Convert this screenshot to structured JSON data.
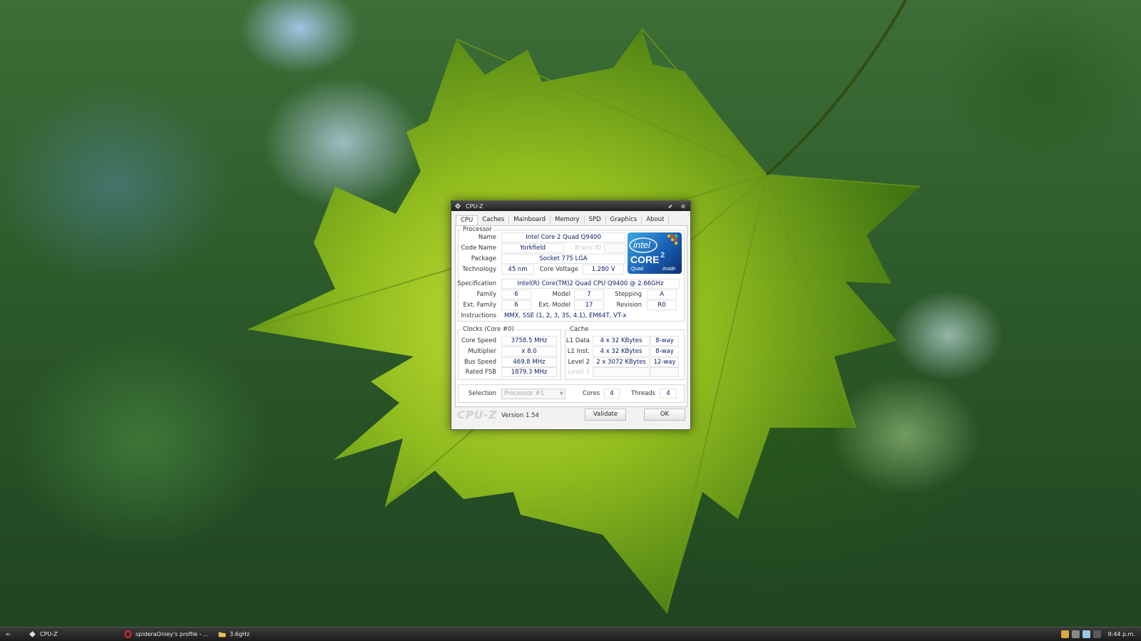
{
  "window": {
    "title": "CPU-Z",
    "controls": {
      "minimize": "⬋",
      "close": "⊗"
    },
    "tabs": [
      "CPU",
      "Caches",
      "Mainboard",
      "Memory",
      "SPD",
      "Graphics",
      "About"
    ],
    "active_tab": "CPU"
  },
  "processor": {
    "legend": "Processor",
    "name_label": "Name",
    "name": "Intel Core 2 Quad Q9400",
    "codename_label": "Code Name",
    "codename": "Yorkfield",
    "brandid_label": "Brand ID",
    "brandid": "",
    "package_label": "Package",
    "package": "Socket 775 LGA",
    "technology_label": "Technology",
    "technology": "45 nm",
    "voltage_label": "Core Voltage",
    "voltage": "1.280 V",
    "spec_label": "Specification",
    "spec": "Intel(R) Core(TM)2 Quad CPU   Q9400  @ 2.66GHz",
    "family_label": "Family",
    "family": "6",
    "model_label": "Model",
    "model": "7",
    "stepping_label": "Stepping",
    "stepping": "A",
    "extfamily_label": "Ext. Family",
    "extfamily": "6",
    "extmodel_label": "Ext. Model",
    "extmodel": "17",
    "revision_label": "Revision",
    "revision": "R0",
    "instructions_label": "Instructions",
    "instructions": "MMX, SSE (1, 2, 3, 3S, 4.1), EM64T, VT-x",
    "logo": {
      "brand": "intel",
      "product": "CORE",
      "tier": "2",
      "variant": "Quad",
      "tagline": "inside"
    }
  },
  "clocks": {
    "legend": "Clocks (Core #0)",
    "corespeed_label": "Core Speed",
    "corespeed": "3758.5 MHz",
    "multiplier_label": "Multiplier",
    "multiplier": "x 8.0",
    "busspeed_label": "Bus Speed",
    "busspeed": "469.8 MHz",
    "fsb_label": "Rated FSB",
    "fsb": "1879.3 MHz"
  },
  "cache": {
    "legend": "Cache",
    "l1d_label": "L1 Data",
    "l1d": "4 x 32 KBytes",
    "l1d_way": "8-way",
    "l1i_label": "L1 Inst.",
    "l1i": "4 x 32 KBytes",
    "l1i_way": "8-way",
    "l2_label": "Level 2",
    "l2": "2 x 3072 KBytes",
    "l2_way": "12-way",
    "l3_label": "Level 3",
    "l3": "",
    "l3_way": ""
  },
  "selection": {
    "label": "Selection",
    "value": "Processor #1",
    "cores_label": "Cores",
    "cores": "4",
    "threads_label": "Threads",
    "threads": "4"
  },
  "footer": {
    "brand": "CPU-Z",
    "version": "Version 1.54",
    "validate": "Validate",
    "ok": "OK"
  },
  "taskbar": {
    "start_glyph": "⇐",
    "tasks": [
      {
        "label": "CPU-Z",
        "icon": "cpuz-icon"
      },
      {
        "label": "spideraOnley's profile - ...",
        "icon": "opera-icon"
      },
      {
        "label": "3.6gHz",
        "icon": "folder-icon"
      }
    ],
    "clock": "9:44 p.m."
  },
  "colors": {
    "value_text": "#0b1a66",
    "taskbar": "#262626",
    "intel_blue": "#1a5fb4"
  }
}
